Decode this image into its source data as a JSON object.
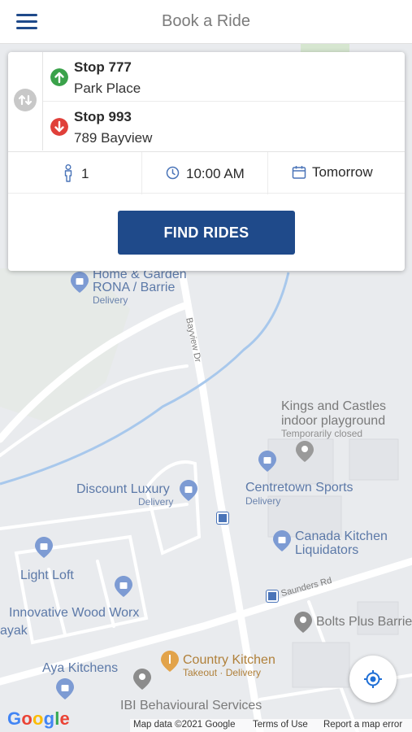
{
  "header": {
    "title": "Book a Ride",
    "menu_icon": "hamburger-menu-icon"
  },
  "trip": {
    "origin": {
      "name": "Stop 777",
      "address": "Park Place",
      "color": "#3aa24a"
    },
    "destination": {
      "name": "Stop 993",
      "address": "789 Bayview",
      "color": "#e0403a"
    },
    "swap_icon": "swap-vertical-icon"
  },
  "options": {
    "passengers": "1",
    "time": "10:00 AM",
    "date": "Tomorrow"
  },
  "actions": {
    "find_rides": "FIND RIDES"
  },
  "map": {
    "places": [
      {
        "name": "Home & Garden",
        "name2": "RONA / Barrie",
        "sub": "Delivery"
      },
      {
        "name": "Kings and Castles",
        "name2": "indoor playground",
        "sub": "Temporarily closed"
      },
      {
        "name": "Discount Luxury",
        "sub": "Delivery"
      },
      {
        "name": "Centretown Sports",
        "sub": "Delivery"
      },
      {
        "name": "Canada Kitchen",
        "name2": "Liquidators"
      },
      {
        "name": "Light Loft"
      },
      {
        "name": "Innovative Wood Worx"
      },
      {
        "name": "ayak"
      },
      {
        "name": "Bolts Plus Barrie"
      },
      {
        "name": "Country Kitchen",
        "sub": "Takeout · Delivery"
      },
      {
        "name": "Aya Kitchens"
      },
      {
        "name": "IBI Behavioural Services"
      }
    ],
    "roads": {
      "road1": "Bayview Dr",
      "road2": "Saunders Rd"
    },
    "footer": {
      "logo": "Google",
      "map_data": "Map data ©2021 Google",
      "terms": "Terms of Use",
      "report": "Report a map error"
    }
  },
  "colors": {
    "brand": "#1f4a8a",
    "poi_blue": "#5c79a8",
    "map_bg": "#e9ebee"
  }
}
